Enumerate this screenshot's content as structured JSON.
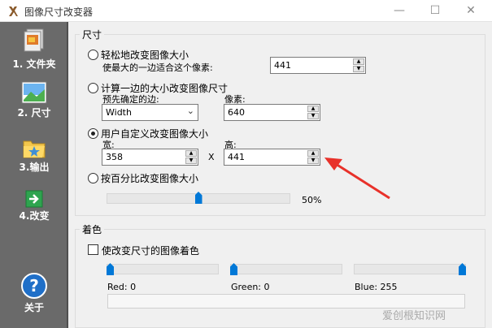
{
  "window": {
    "title": "图像尺寸改变器",
    "btn_min": "—",
    "btn_max": "☐",
    "btn_close": "✕"
  },
  "sidebar": {
    "items": [
      {
        "label": "1. 文件夹",
        "icon": "folder-images-icon"
      },
      {
        "label": "2. 尺寸",
        "icon": "picture-icon"
      },
      {
        "label": "3.输出",
        "icon": "folder-star-icon"
      },
      {
        "label": "4.改变",
        "icon": "green-arrow-icon"
      }
    ],
    "about": {
      "label": "关于",
      "icon": "help-icon"
    }
  },
  "size_group": {
    "title": "尺寸",
    "opt1": {
      "label": "轻松地改变图像大小",
      "sub_label": "使最大的一边适合这个像素:",
      "value": "441",
      "checked": false
    },
    "opt2": {
      "label": "计算一边的大小改变图像尺寸",
      "side_label": "预先确定的边:",
      "side_value": "Width",
      "px_label": "像素:",
      "px_value": "640",
      "checked": false
    },
    "opt3": {
      "label": "用户自定义改变图像大小",
      "width_label": "宽:",
      "width_value": "358",
      "x_label": "X",
      "height_label": "高:",
      "height_value": "441",
      "checked": true
    },
    "opt4": {
      "label": "按百分比改变图像大小",
      "percent": 50,
      "percent_text": "50%",
      "checked": false
    }
  },
  "color_group": {
    "title": "着色",
    "checkbox_label": "使改变尺寸的图像着色",
    "checked": false,
    "red": {
      "label": "Red: 0",
      "value": 0
    },
    "green": {
      "label": "Green: 0",
      "value": 0
    },
    "blue": {
      "label": "Blue: 255",
      "value": 255
    }
  },
  "watermark": "爱创根知识网",
  "colors": {
    "accent": "#0078d7",
    "sidebar_bg": "#6a6a6a",
    "annotation": "#e8312a"
  }
}
